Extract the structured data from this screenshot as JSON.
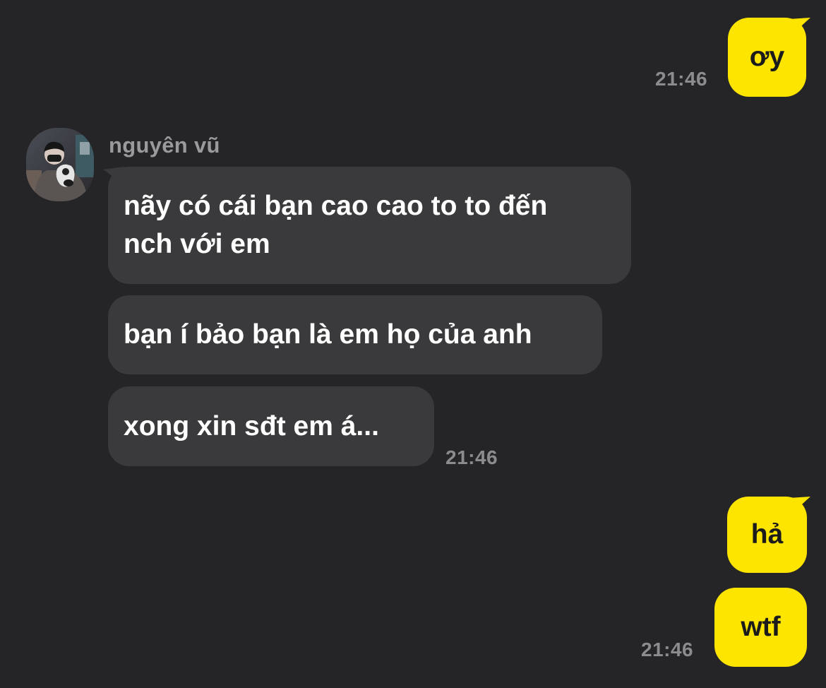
{
  "conversation": {
    "contact_name": "nguyên vũ",
    "messages": [
      {
        "direction": "out",
        "text": "ơy",
        "time": "21:46"
      },
      {
        "direction": "in",
        "text": "nãy có cái bạn cao cao to to đến nch với em",
        "line1": "nãy có cái bạn cao cao to to đến",
        "line2": "nch với em"
      },
      {
        "direction": "in",
        "text": "bạn í bảo bạn là em họ của anh"
      },
      {
        "direction": "in",
        "text": "xong xin sđt em á...",
        "time": "21:46"
      },
      {
        "direction": "out",
        "text": "hả"
      },
      {
        "direction": "out",
        "text": "wtf",
        "time": "21:46"
      }
    ]
  },
  "colors": {
    "background": "#252527",
    "outgoing_bubble": "#FEE500",
    "incoming_bubble": "#3a3a3d",
    "timestamp": "#8c8c8f"
  },
  "icons": {
    "avatar": "contact-avatar-photo"
  }
}
